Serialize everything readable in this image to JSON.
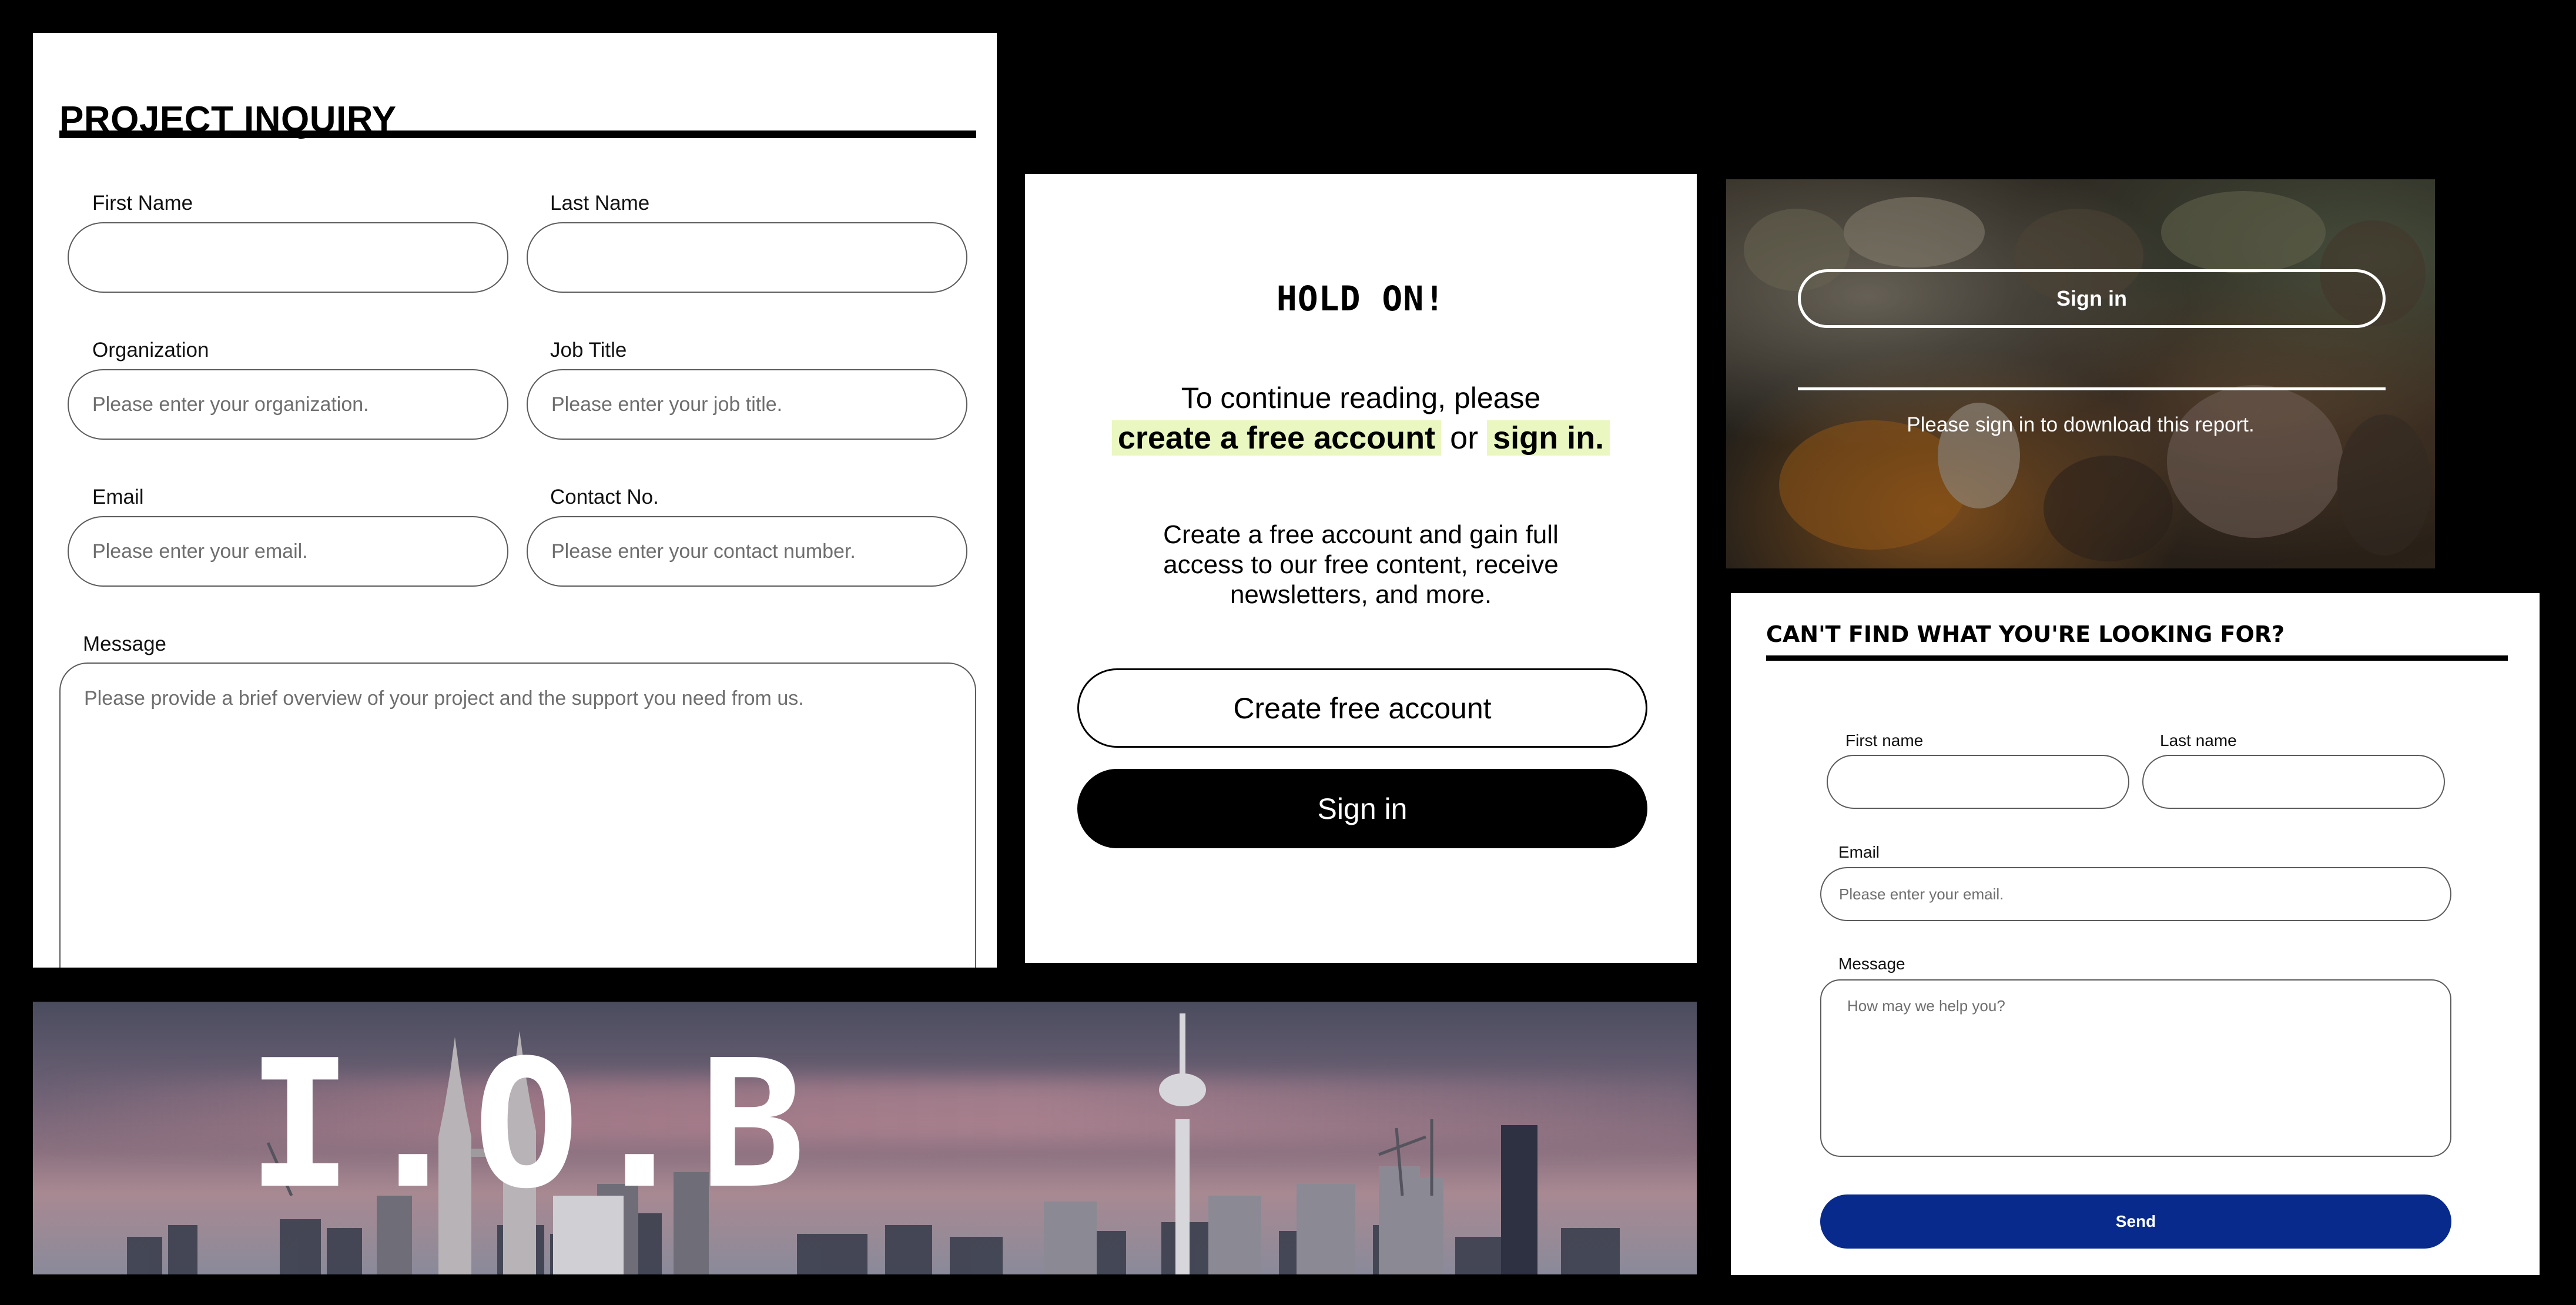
{
  "inquiry": {
    "title": "PROJECT INQUIRY",
    "first_name": {
      "label": "First Name",
      "placeholder": ""
    },
    "last_name": {
      "label": "Last Name",
      "placeholder": ""
    },
    "organization": {
      "label": "Organization",
      "placeholder": "Please enter your organization."
    },
    "job_title": {
      "label": "Job Title",
      "placeholder": "Please enter your job title."
    },
    "email": {
      "label": "Email",
      "placeholder": "Please enter your email."
    },
    "contact": {
      "label": "Contact No.",
      "placeholder": "Please enter your contact number."
    },
    "message": {
      "label": "Message",
      "placeholder": "Please provide a brief overview of your project and the support you need from us."
    }
  },
  "holdon": {
    "heading": "HOLD ON!",
    "line1": "To continue reading, please",
    "create_link": "create a free account",
    "or_text": " or ",
    "signin_link": "sign in.",
    "description": "Create a free account and gain full access to our free content, receive newsletters, and more.",
    "create_button": "Create free account",
    "signin_button": "Sign in"
  },
  "download": {
    "signin_button": "Sign in",
    "note": "Please sign in to download this report."
  },
  "cantfind": {
    "title": "CAN'T FIND WHAT YOU'RE LOOKING FOR?",
    "first_name": {
      "label": "First name",
      "placeholder": ""
    },
    "last_name": {
      "label": "Last name",
      "placeholder": ""
    },
    "email": {
      "label": "Email",
      "placeholder": "Please enter your email."
    },
    "message": {
      "label": "Message",
      "placeholder": "How may we help you?"
    },
    "send_button": "Send",
    "send_color": "#082a8c"
  },
  "banner": {
    "logo_text": "I.O.B"
  }
}
